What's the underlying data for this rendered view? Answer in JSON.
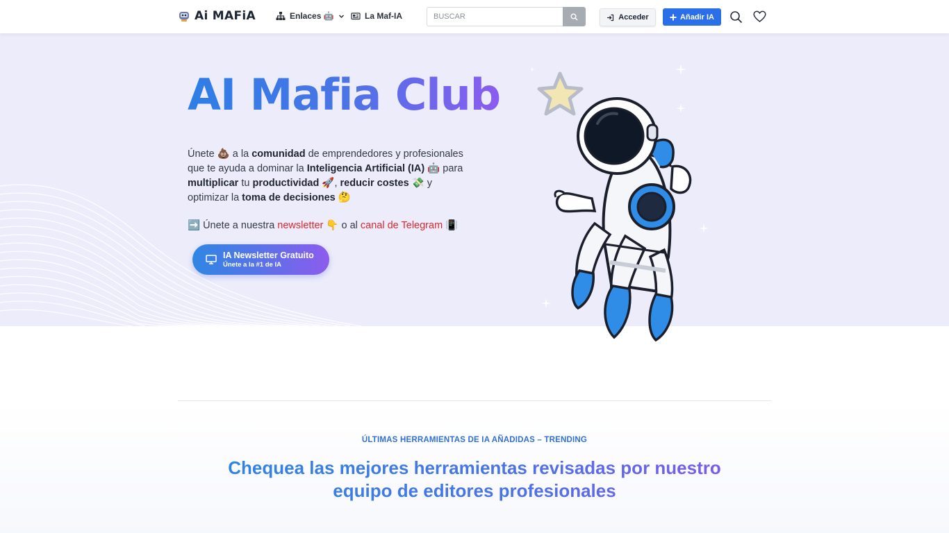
{
  "brand": {
    "name": "Ai MAFiA"
  },
  "nav": {
    "links": [
      {
        "label": "Enlaces 🤖",
        "icon": "sitemap-icon"
      },
      {
        "label": "La Maf-IA",
        "icon": "newspaper-icon"
      }
    ],
    "search": {
      "placeholder": "BUSCAR"
    },
    "login_label": "Acceder",
    "add_label": "Añadir IA",
    "colors": {
      "primary": "#2a6fe8"
    }
  },
  "hero": {
    "title": "AI Mafia Club",
    "desc": {
      "p1": "Únete 💩 a la ",
      "b1": "comunidad",
      "p2": " de emprendedores y profesionales que te ayuda a dominar la ",
      "b2": "Inteligencia Artificial (IA)",
      "p3": " 🤖 para ",
      "b3": "multiplicar",
      "p4": " tu ",
      "b4": "productividad",
      "p5": " 🚀,  ",
      "b5": "reducir costes",
      "p6": " 💸 y optimizar la ",
      "b6": "toma de decisiones",
      "p7": " 🤔"
    },
    "cta": {
      "prefix": "➡️ Únete a nuestra ",
      "newsletter_link": "newsletter",
      "middle": " 👇 o al ",
      "telegram_link": "canal de Telegram",
      "suffix": " 📳"
    },
    "button": {
      "title": "IA Newsletter Gratuito",
      "subtitle": "Únete a la #1 de IA"
    },
    "colors": {
      "gradient_start": "#2d7ee6",
      "gradient_end": "#8b5cf0",
      "background": "#ececfb",
      "link_red": "#e0262e"
    }
  },
  "section": {
    "eyebrow": "ÚLTIMAS HERRAMIENTAS DE IA AÑADIDAS – TRENDING",
    "title": "Chequea las mejores herramientas revisadas por nuestro equipo de editores profesionales"
  }
}
